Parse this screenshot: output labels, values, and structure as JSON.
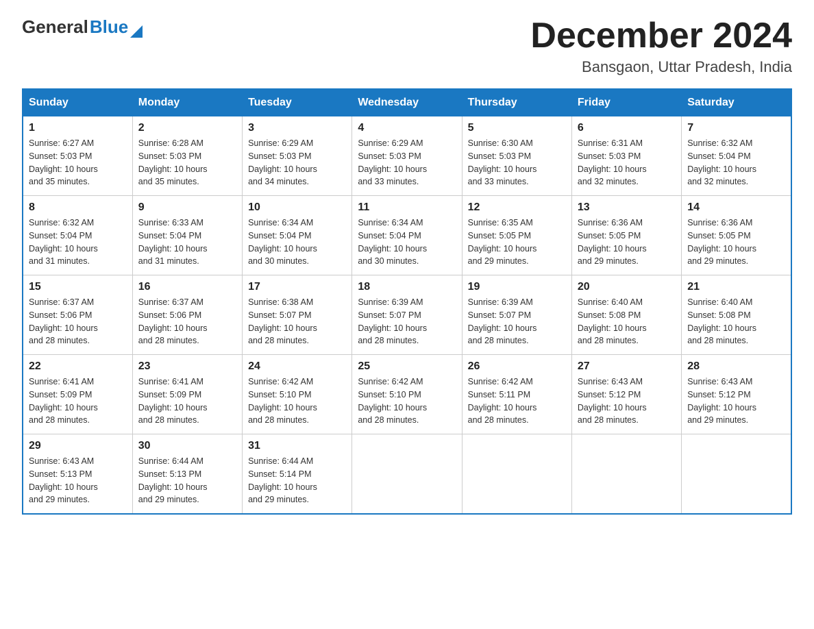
{
  "header": {
    "title": "December 2024",
    "subtitle": "Bansgaon, Uttar Pradesh, India",
    "logo_general": "General",
    "logo_blue": "Blue"
  },
  "columns": [
    "Sunday",
    "Monday",
    "Tuesday",
    "Wednesday",
    "Thursday",
    "Friday",
    "Saturday"
  ],
  "weeks": [
    [
      {
        "day": "1",
        "info": "Sunrise: 6:27 AM\nSunset: 5:03 PM\nDaylight: 10 hours\nand 35 minutes."
      },
      {
        "day": "2",
        "info": "Sunrise: 6:28 AM\nSunset: 5:03 PM\nDaylight: 10 hours\nand 35 minutes."
      },
      {
        "day": "3",
        "info": "Sunrise: 6:29 AM\nSunset: 5:03 PM\nDaylight: 10 hours\nand 34 minutes."
      },
      {
        "day": "4",
        "info": "Sunrise: 6:29 AM\nSunset: 5:03 PM\nDaylight: 10 hours\nand 33 minutes."
      },
      {
        "day": "5",
        "info": "Sunrise: 6:30 AM\nSunset: 5:03 PM\nDaylight: 10 hours\nand 33 minutes."
      },
      {
        "day": "6",
        "info": "Sunrise: 6:31 AM\nSunset: 5:03 PM\nDaylight: 10 hours\nand 32 minutes."
      },
      {
        "day": "7",
        "info": "Sunrise: 6:32 AM\nSunset: 5:04 PM\nDaylight: 10 hours\nand 32 minutes."
      }
    ],
    [
      {
        "day": "8",
        "info": "Sunrise: 6:32 AM\nSunset: 5:04 PM\nDaylight: 10 hours\nand 31 minutes."
      },
      {
        "day": "9",
        "info": "Sunrise: 6:33 AM\nSunset: 5:04 PM\nDaylight: 10 hours\nand 31 minutes."
      },
      {
        "day": "10",
        "info": "Sunrise: 6:34 AM\nSunset: 5:04 PM\nDaylight: 10 hours\nand 30 minutes."
      },
      {
        "day": "11",
        "info": "Sunrise: 6:34 AM\nSunset: 5:04 PM\nDaylight: 10 hours\nand 30 minutes."
      },
      {
        "day": "12",
        "info": "Sunrise: 6:35 AM\nSunset: 5:05 PM\nDaylight: 10 hours\nand 29 minutes."
      },
      {
        "day": "13",
        "info": "Sunrise: 6:36 AM\nSunset: 5:05 PM\nDaylight: 10 hours\nand 29 minutes."
      },
      {
        "day": "14",
        "info": "Sunrise: 6:36 AM\nSunset: 5:05 PM\nDaylight: 10 hours\nand 29 minutes."
      }
    ],
    [
      {
        "day": "15",
        "info": "Sunrise: 6:37 AM\nSunset: 5:06 PM\nDaylight: 10 hours\nand 28 minutes."
      },
      {
        "day": "16",
        "info": "Sunrise: 6:37 AM\nSunset: 5:06 PM\nDaylight: 10 hours\nand 28 minutes."
      },
      {
        "day": "17",
        "info": "Sunrise: 6:38 AM\nSunset: 5:07 PM\nDaylight: 10 hours\nand 28 minutes."
      },
      {
        "day": "18",
        "info": "Sunrise: 6:39 AM\nSunset: 5:07 PM\nDaylight: 10 hours\nand 28 minutes."
      },
      {
        "day": "19",
        "info": "Sunrise: 6:39 AM\nSunset: 5:07 PM\nDaylight: 10 hours\nand 28 minutes."
      },
      {
        "day": "20",
        "info": "Sunrise: 6:40 AM\nSunset: 5:08 PM\nDaylight: 10 hours\nand 28 minutes."
      },
      {
        "day": "21",
        "info": "Sunrise: 6:40 AM\nSunset: 5:08 PM\nDaylight: 10 hours\nand 28 minutes."
      }
    ],
    [
      {
        "day": "22",
        "info": "Sunrise: 6:41 AM\nSunset: 5:09 PM\nDaylight: 10 hours\nand 28 minutes."
      },
      {
        "day": "23",
        "info": "Sunrise: 6:41 AM\nSunset: 5:09 PM\nDaylight: 10 hours\nand 28 minutes."
      },
      {
        "day": "24",
        "info": "Sunrise: 6:42 AM\nSunset: 5:10 PM\nDaylight: 10 hours\nand 28 minutes."
      },
      {
        "day": "25",
        "info": "Sunrise: 6:42 AM\nSunset: 5:10 PM\nDaylight: 10 hours\nand 28 minutes."
      },
      {
        "day": "26",
        "info": "Sunrise: 6:42 AM\nSunset: 5:11 PM\nDaylight: 10 hours\nand 28 minutes."
      },
      {
        "day": "27",
        "info": "Sunrise: 6:43 AM\nSunset: 5:12 PM\nDaylight: 10 hours\nand 28 minutes."
      },
      {
        "day": "28",
        "info": "Sunrise: 6:43 AM\nSunset: 5:12 PM\nDaylight: 10 hours\nand 29 minutes."
      }
    ],
    [
      {
        "day": "29",
        "info": "Sunrise: 6:43 AM\nSunset: 5:13 PM\nDaylight: 10 hours\nand 29 minutes."
      },
      {
        "day": "30",
        "info": "Sunrise: 6:44 AM\nSunset: 5:13 PM\nDaylight: 10 hours\nand 29 minutes."
      },
      {
        "day": "31",
        "info": "Sunrise: 6:44 AM\nSunset: 5:14 PM\nDaylight: 10 hours\nand 29 minutes."
      },
      {
        "day": "",
        "info": ""
      },
      {
        "day": "",
        "info": ""
      },
      {
        "day": "",
        "info": ""
      },
      {
        "day": "",
        "info": ""
      }
    ]
  ]
}
